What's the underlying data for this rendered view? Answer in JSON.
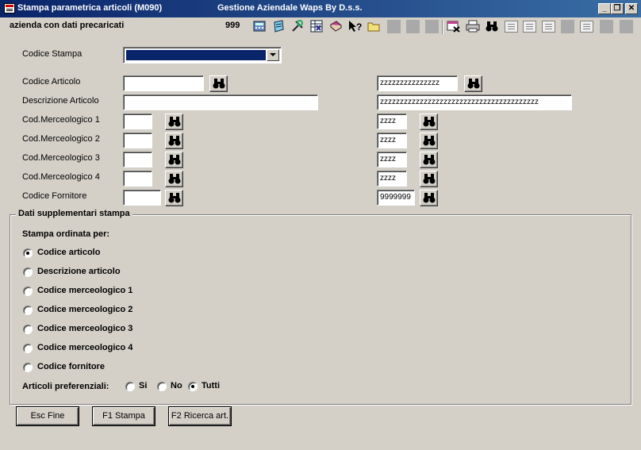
{
  "window": {
    "title": "Stampa parametrica articoli (M090)",
    "app_title": "Gestione Aziendale Waps By D.s.s.",
    "minimize": "_",
    "maximize": "❐",
    "close": "✕"
  },
  "header": {
    "company": "azienda con dati precaricati",
    "company_code": "999"
  },
  "toolbar": {
    "icons": [
      "calculator-icon",
      "notes-icon",
      "tools-icon",
      "spreadsheet-icon",
      "book-icon",
      "help-icon",
      "folder-icon",
      "disabled-icon",
      "disabled-icon",
      "disabled-icon",
      "calendar-close-icon",
      "printer-icon",
      "binoculars-icon",
      "list-icon",
      "list-icon",
      "list-icon",
      "list-icon",
      "list-disabled-icon",
      "list-icon",
      "disabled-icon",
      "disabled-icon"
    ]
  },
  "form": {
    "codice_stampa_label": "Codice Stampa",
    "codice_stampa_value": "",
    "rows": [
      {
        "label": "Codice Articolo",
        "from": "",
        "to": "zzzzzzzzzzzzzzz"
      },
      {
        "label": "Descrizione Articolo",
        "from": "",
        "to": "zzzzzzzzzzzzzzzzzzzzzzzzzzzzzzzzzzzzzzzz"
      },
      {
        "label": "Cod.Merceologico 1",
        "from": "",
        "to": "zzzz"
      },
      {
        "label": "Cod.Merceologico 2",
        "from": "",
        "to": "zzzz"
      },
      {
        "label": "Cod.Merceologico 3",
        "from": "",
        "to": "zzzz"
      },
      {
        "label": "Cod.Merceologico 4",
        "from": "",
        "to": "zzzz"
      },
      {
        "label": "Codice Fornitore",
        "from": "",
        "to": "9999999"
      }
    ]
  },
  "group": {
    "title": "Dati supplementari stampa",
    "order_label": "Stampa ordinata per:",
    "order_options": [
      {
        "label": "Codice articolo",
        "selected": true
      },
      {
        "label": "Descrizione articolo",
        "selected": false
      },
      {
        "label": "Codice merceologico 1",
        "selected": false
      },
      {
        "label": "Codice merceologico 2",
        "selected": false
      },
      {
        "label": "Codice merceologico 3",
        "selected": false
      },
      {
        "label": "Codice merceologico 4",
        "selected": false
      },
      {
        "label": "Codice fornitore",
        "selected": false
      }
    ],
    "pref_label": "Articoli preferenziali:",
    "pref_options": [
      {
        "label": "Si",
        "selected": false
      },
      {
        "label": "No",
        "selected": false
      },
      {
        "label": "Tutti",
        "selected": true
      }
    ]
  },
  "buttons": {
    "esc": "Esc Fine",
    "f1": "F1 Stampa",
    "f2": "F2 Ricerca art."
  },
  "colors": {
    "titlebar_start": "#0a246a",
    "titlebar_end": "#3a6ea5",
    "face": "#d4d0c8"
  }
}
